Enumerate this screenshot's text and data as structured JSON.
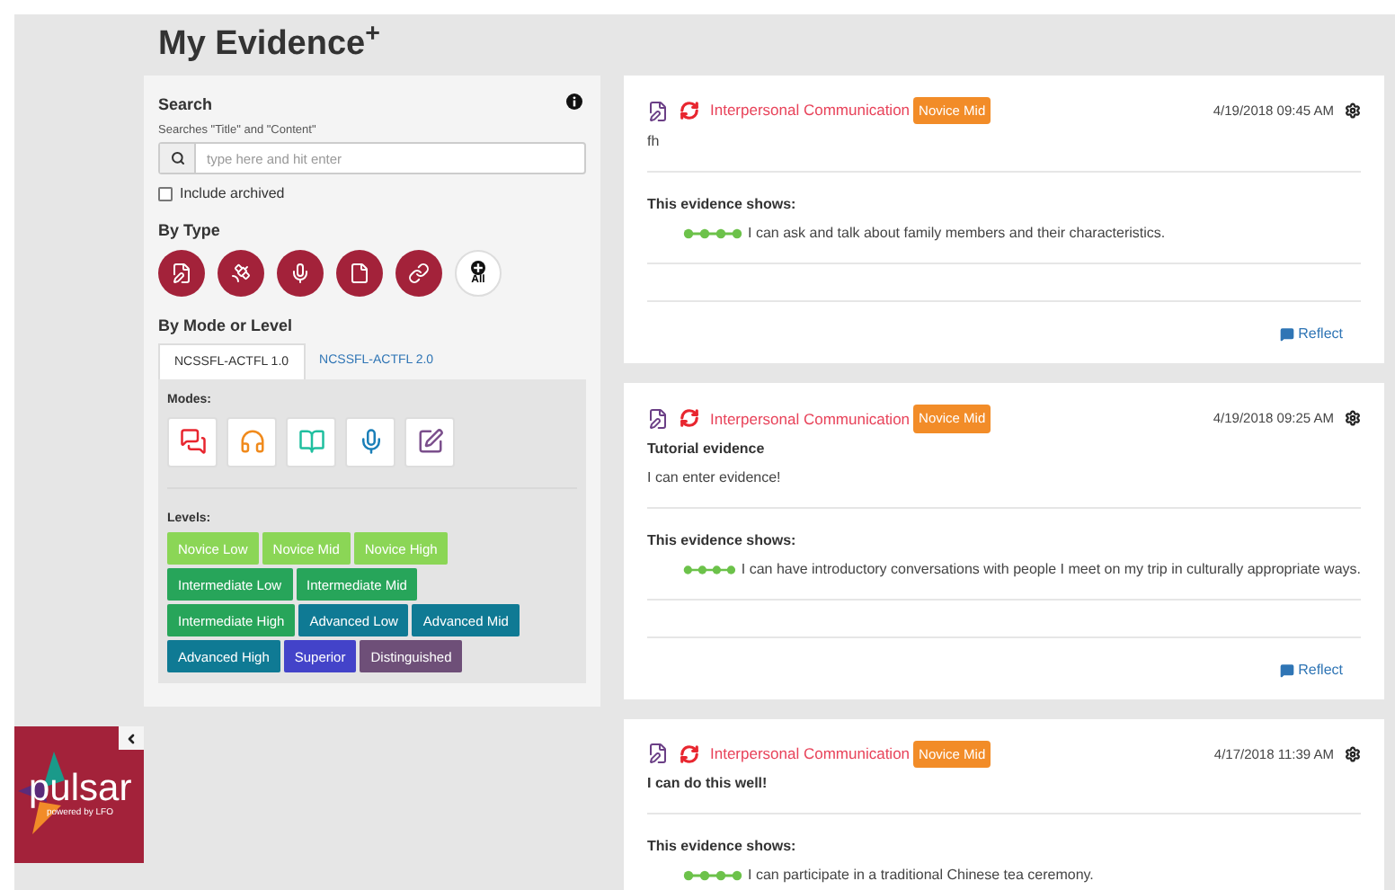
{
  "page": {
    "title": "My Evidence$^{+}$"
  },
  "sidebar": {
    "search": {
      "heading": "Search",
      "hint": "Searches \"Title\" and \"Content\"",
      "placeholder": "type here and hit enter"
    },
    "include_archived": {
      "label": "Include archived",
      "checked": false
    },
    "by_type": {
      "heading": "By Type",
      "all_label": "All"
    },
    "by_mode_or_level": {
      "heading": "By Mode or Level",
      "tabs": [
        {
          "label": "NCSSFL-ACTFL 1.0",
          "selected": true
        },
        {
          "label": "NCSSFL-ACTFL 2.0",
          "selected": false
        }
      ],
      "modes_label": "Modes:",
      "levels_label": "Levels:",
      "levels": [
        {
          "label": "Novice Low",
          "color": "#8bd656"
        },
        {
          "label": "Novice Mid",
          "color": "#8bd656"
        },
        {
          "label": "Novice High",
          "color": "#8bd656"
        },
        {
          "label": "Intermediate Low",
          "color": "#27a55a"
        },
        {
          "label": "Intermediate Mid",
          "color": "#27a55a"
        },
        {
          "label": "Intermediate High",
          "color": "#27a55a"
        },
        {
          "label": "Advanced Low",
          "color": "#0f7a94"
        },
        {
          "label": "Advanced Mid",
          "color": "#0f7a94"
        },
        {
          "label": "Advanced High",
          "color": "#0f7a94"
        },
        {
          "label": "Superior",
          "color": "#4343c9"
        },
        {
          "label": "Distinguished",
          "color": "#6e4f78"
        }
      ]
    }
  },
  "logo": {
    "name": "pulsar",
    "tagline": "powered by LFO"
  },
  "evidence": [
    {
      "mode": "Interpersonal Communication",
      "level": "Novice Mid",
      "timestamp": "4/19/2018 09:45 AM",
      "text": "fh",
      "shows_heading": "This evidence shows:",
      "statement": "I can ask and talk about family members and their characteristics.",
      "reflect": "Reflect"
    },
    {
      "mode": "Interpersonal Communication",
      "level": "Novice Mid",
      "timestamp": "4/19/2018 09:25 AM",
      "title": "Tutorial evidence",
      "text": "I can enter evidence!",
      "shows_heading": "This evidence shows:",
      "statement": "I can have introductory conversations with people I meet on my trip in culturally appropriate ways.",
      "reflect": "Reflect"
    },
    {
      "mode": "Interpersonal Communication",
      "level": "Novice Mid",
      "timestamp": "4/17/2018 11:39 AM",
      "title": "I can do this well!",
      "shows_heading": "This evidence shows:",
      "statement": "I can participate in a traditional Chinese tea ceremony."
    }
  ]
}
